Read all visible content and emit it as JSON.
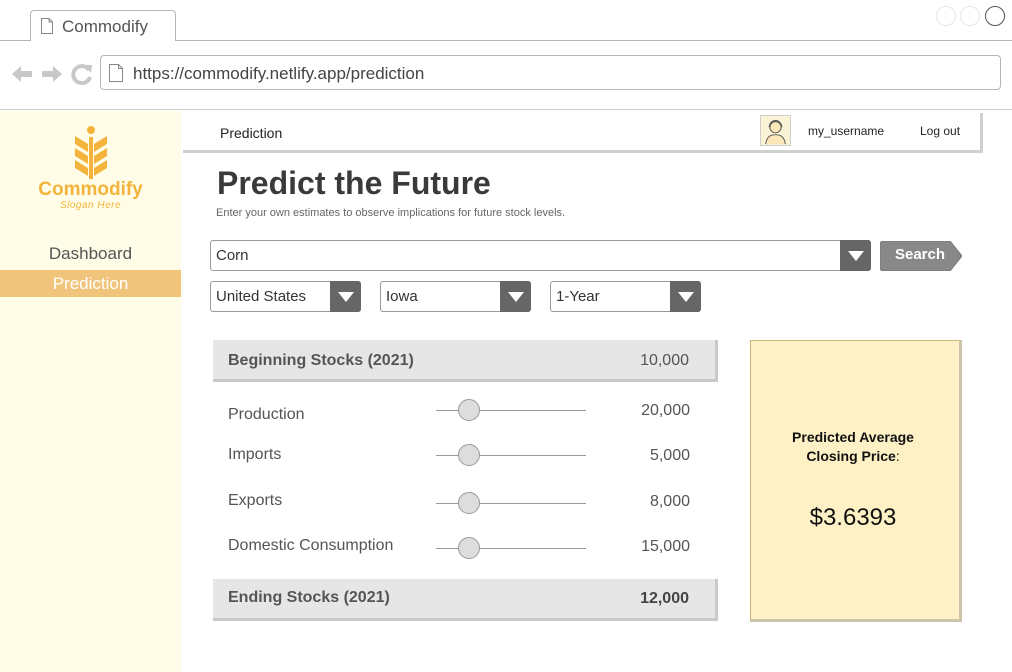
{
  "browser": {
    "tab_title": "Commodify",
    "url": "https://commodify.netlify.app/prediction"
  },
  "sidebar": {
    "brand": "Commodify",
    "slogan": "Slogan Here",
    "items": [
      {
        "label": "Dashboard",
        "active": false
      },
      {
        "label": "Prediction",
        "active": true
      }
    ]
  },
  "header": {
    "section": "Prediction",
    "username": "my_username",
    "logout": "Log out"
  },
  "main": {
    "title": "Predict the Future",
    "subtitle": "Enter your own estimates to observe implications for future stock levels.",
    "commodity": "Corn",
    "search_label": "Search",
    "country": "United States",
    "state": "Iowa",
    "horizon": "1-Year"
  },
  "table": {
    "beginning": {
      "label": "Beginning Stocks (2021)",
      "value": "10,000"
    },
    "controls": [
      {
        "label": "Production",
        "value": "20,000",
        "slider": 0.22
      },
      {
        "label": "Imports",
        "value": "5,000",
        "slider": 0.22
      },
      {
        "label": "Exports",
        "value": "8,000",
        "slider": 0.22
      },
      {
        "label": "Domestic Consumption",
        "value": "15,000",
        "slider": 0.22
      }
    ],
    "ending": {
      "label": "Ending Stocks (2021)",
      "value": "12,000"
    }
  },
  "prediction": {
    "label_line1": "Predicted Average",
    "label_line2": "Closing Price",
    "label_colon": ":",
    "value": "$3.6393"
  },
  "colors": {
    "accent": "#f4b33a",
    "active_nav": "#f0c47a",
    "sidebar_bg": "#fffde8",
    "card_bg": "#fff1c6",
    "button": "#888888"
  }
}
